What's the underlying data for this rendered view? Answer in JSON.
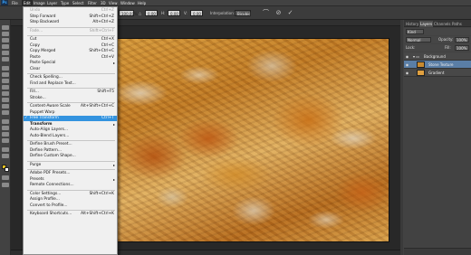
{
  "app": {
    "logo": "Ps",
    "menus": [
      "File",
      "Edit",
      "Image",
      "Layer",
      "Type",
      "Select",
      "Filter",
      "3D",
      "View",
      "Window",
      "Help"
    ],
    "active_menu": "Edit"
  },
  "options_bar": {
    "zoom": "100.00%",
    "field_2": "0.00",
    "field_3": "0.00",
    "interpolation_label": "Interpolation:",
    "interpolation_value": "Bicubic",
    "cancel_icon": "cancel-icon",
    "commit_icon": "commit-check-icon"
  },
  "edit_menu": {
    "items": [
      {
        "label": "Undo",
        "shortcut": "Ctrl+Z",
        "disabled": true
      },
      {
        "label": "Step Forward",
        "shortcut": "Shift+Ctrl+Z",
        "disabled": false
      },
      {
        "label": "Step Backward",
        "shortcut": "Alt+Ctrl+Z",
        "disabled": false
      },
      {
        "sep": true
      },
      {
        "label": "Fade...",
        "shortcut": "Shift+Ctrl+F",
        "disabled": true
      },
      {
        "sep": true
      },
      {
        "label": "Cut",
        "shortcut": "Ctrl+X",
        "disabled": false
      },
      {
        "label": "Copy",
        "shortcut": "Ctrl+C",
        "disabled": false
      },
      {
        "label": "Copy Merged",
        "shortcut": "Shift+Ctrl+C",
        "disabled": false
      },
      {
        "label": "Paste",
        "shortcut": "Ctrl+V",
        "disabled": false
      },
      {
        "label": "Paste Special",
        "shortcut": "",
        "disabled": false,
        "submenu": true
      },
      {
        "label": "Clear",
        "shortcut": "",
        "disabled": false
      },
      {
        "sep": true
      },
      {
        "label": "Check Spelling...",
        "shortcut": "",
        "disabled": false
      },
      {
        "label": "Find and Replace Text...",
        "shortcut": "",
        "disabled": false
      },
      {
        "sep": true
      },
      {
        "label": "Fill...",
        "shortcut": "Shift+F5",
        "disabled": false
      },
      {
        "label": "Stroke...",
        "shortcut": "",
        "disabled": false
      },
      {
        "sep": true
      },
      {
        "label": "Content-Aware Scale",
        "shortcut": "Alt+Shift+Ctrl+C",
        "disabled": false
      },
      {
        "label": "Puppet Warp",
        "shortcut": "",
        "disabled": false
      },
      {
        "label": "Free Transform",
        "shortcut": "Ctrl+T",
        "disabled": false,
        "highlighted": true,
        "checked": true
      },
      {
        "label": "Transform",
        "shortcut": "",
        "disabled": false,
        "submenu": true,
        "bold": true
      },
      {
        "label": "Auto-Align Layers...",
        "shortcut": "",
        "disabled": false
      },
      {
        "label": "Auto-Blend Layers...",
        "shortcut": "",
        "disabled": false
      },
      {
        "sep": true
      },
      {
        "label": "Define Brush Preset...",
        "shortcut": "",
        "disabled": false
      },
      {
        "label": "Define Pattern...",
        "shortcut": "",
        "disabled": false
      },
      {
        "label": "Define Custom Shape...",
        "shortcut": "",
        "disabled": false
      },
      {
        "sep": true
      },
      {
        "label": "Purge",
        "shortcut": "",
        "disabled": false,
        "submenu": true
      },
      {
        "sep": true
      },
      {
        "label": "Adobe PDF Presets...",
        "shortcut": "",
        "disabled": false
      },
      {
        "label": "Presets",
        "shortcut": "",
        "disabled": false,
        "submenu": true
      },
      {
        "label": "Remote Connections...",
        "shortcut": "",
        "disabled": false
      },
      {
        "sep": true
      },
      {
        "label": "Color Settings...",
        "shortcut": "Shift+Ctrl+K",
        "disabled": false
      },
      {
        "label": "Assign Profile...",
        "shortcut": "",
        "disabled": false
      },
      {
        "label": "Convert to Profile...",
        "shortcut": "",
        "disabled": false
      },
      {
        "sep": true
      },
      {
        "label": "Keyboard Shortcuts...",
        "shortcut": "Alt+Shift+Ctrl+K",
        "disabled": false
      }
    ]
  },
  "panels": {
    "tabs": [
      "History",
      "Layers",
      "Channels",
      "Paths"
    ],
    "active_tab": "Layers",
    "kind_filter": "Kind",
    "blend_mode": "Normal",
    "opacity_label": "Opacity:",
    "opacity_value": "100%",
    "lock_label": "Lock:",
    "fill_label": "Fill:",
    "fill_value": "100%",
    "layers": [
      {
        "name": "Background",
        "thumb": "#7a7a7a",
        "selected": false,
        "group": true
      },
      {
        "name": "Stone Texture",
        "thumb": "#c88a30",
        "selected": true
      },
      {
        "name": "Gradient",
        "thumb": "#e0a040",
        "selected": false
      }
    ]
  },
  "colors": {
    "menu_highlight": "#3393df",
    "layer_selected": "#5a7ea6",
    "chrome_dark": "#424242"
  }
}
